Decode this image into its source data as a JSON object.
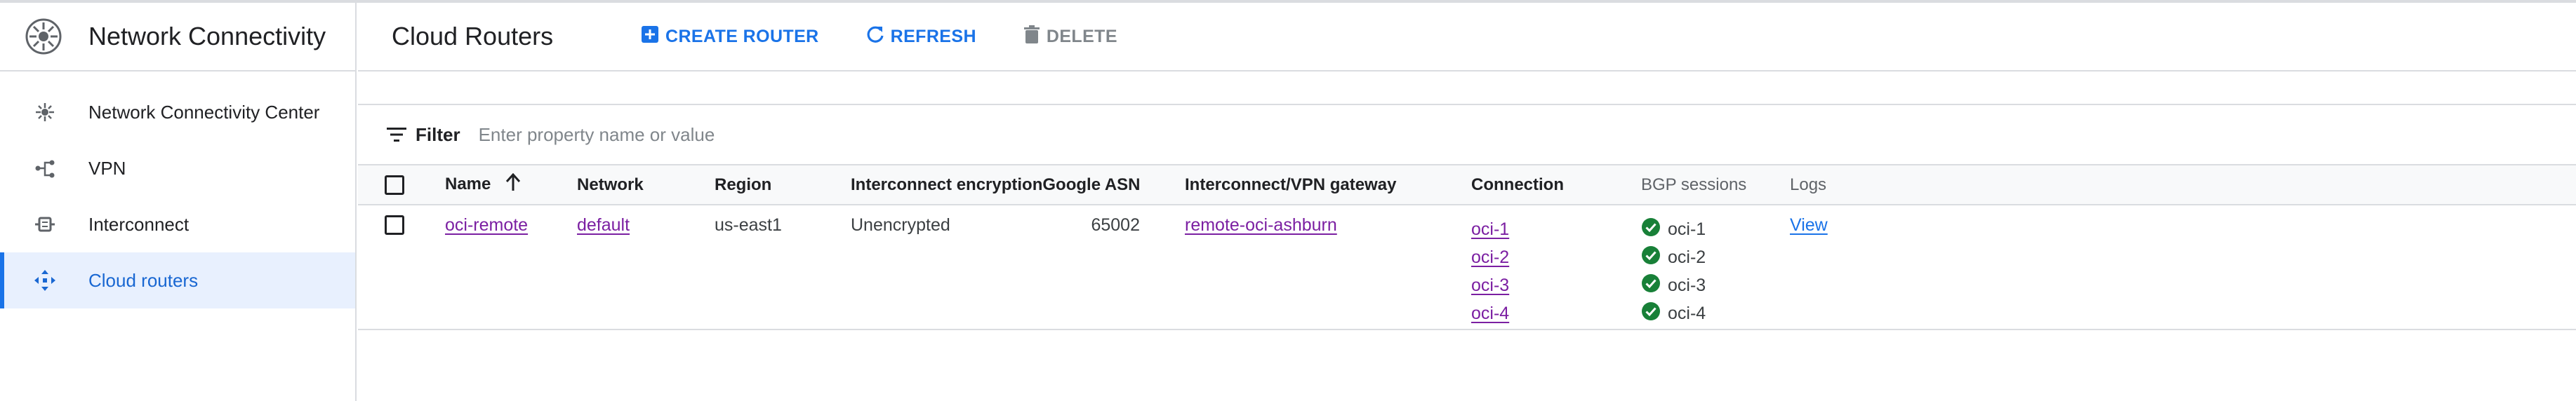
{
  "sidebar": {
    "title": "Network Connectivity",
    "items": [
      {
        "label": "Network Connectivity Center",
        "icon": "hub-icon"
      },
      {
        "label": "VPN",
        "icon": "vpn-icon"
      },
      {
        "label": "Interconnect",
        "icon": "interconnect-icon"
      },
      {
        "label": "Cloud routers",
        "icon": "cloud-router-icon",
        "active": true
      }
    ]
  },
  "toolbar": {
    "title": "Cloud Routers",
    "create_label": "CREATE ROUTER",
    "refresh_label": "REFRESH",
    "delete_label": "DELETE"
  },
  "filter": {
    "label": "Filter",
    "placeholder": "Enter property name or value"
  },
  "table": {
    "headers": {
      "name": "Name",
      "network": "Network",
      "region": "Region",
      "encryption": "Interconnect encryption",
      "asn": "Google ASN",
      "gateway": "Interconnect/VPN gateway",
      "connection": "Connection",
      "bgp": "BGP sessions",
      "logs": "Logs"
    },
    "rows": [
      {
        "name": "oci-remote",
        "network": "default",
        "region": "us-east1",
        "encryption": "Unencrypted",
        "asn": "65002",
        "gateway": "remote-oci-ashburn",
        "connections": [
          "oci-1",
          "oci-2",
          "oci-3",
          "oci-4"
        ],
        "bgp_sessions": [
          "oci-1",
          "oci-2",
          "oci-3",
          "oci-4"
        ],
        "logs": "View"
      }
    ]
  },
  "colors": {
    "accent": "#1a73e8",
    "link_visited": "#7b1fa2",
    "success": "#188038",
    "active_bg": "#e8f0fe"
  }
}
